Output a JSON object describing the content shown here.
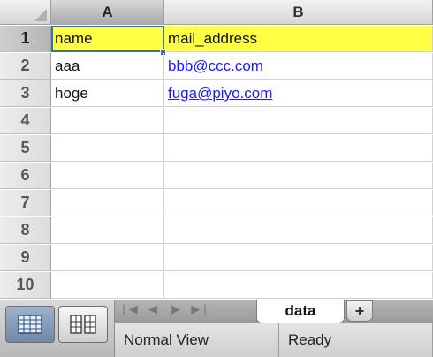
{
  "columns": [
    "A",
    "B"
  ],
  "rows": [
    "1",
    "2",
    "3",
    "4",
    "5",
    "6",
    "7",
    "8",
    "9",
    "10"
  ],
  "cells": [
    {
      "a": "name",
      "b": "mail_address"
    },
    {
      "a": "aaa",
      "b": "bbb@ccc.com"
    },
    {
      "a": "hoge",
      "b": "fuga@piyo.com"
    }
  ],
  "colors": {
    "header_fill": "#ffff44",
    "link": "#1a1aff",
    "selection": "#3a6fb0"
  },
  "sheet_tab": {
    "name": "data",
    "add_label": "+"
  },
  "tab_nav": [
    "|◀",
    "◀",
    "▶",
    "▶|"
  ],
  "status": {
    "view_mode": "Normal View",
    "state": "Ready"
  },
  "icons": {
    "normal_view": "grid-view-icon",
    "page_layout": "page-layout-icon"
  }
}
